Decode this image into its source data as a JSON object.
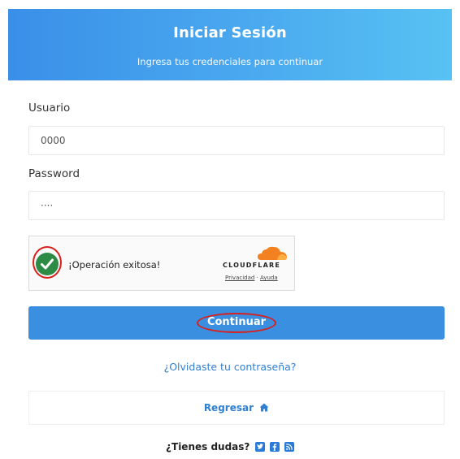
{
  "header": {
    "title": "Iniciar Sesión",
    "subtitle": "Ingresa tus credenciales para continuar"
  },
  "form": {
    "username_label": "Usuario",
    "username_value": "0000",
    "password_label": "Password",
    "password_value": "····"
  },
  "captcha": {
    "status_icon": "check-circle-icon",
    "message": "¡Operación exitosa!",
    "provider": "CLOUDFLARE",
    "privacy_link": "Privacidad",
    "separator": "·",
    "help_link": "Ayuda"
  },
  "actions": {
    "continue_label": "Continuar",
    "forgot_label": "¿Olvidaste tu contraseña?",
    "back_label": "Regresar",
    "back_icon": "home-icon"
  },
  "footer": {
    "question": "¿Tienes dudas?",
    "social_icons": [
      "twitter-icon",
      "facebook-icon",
      "rss-icon"
    ]
  },
  "colors": {
    "header_gradient_start": "#3a8fe8",
    "header_gradient_end": "#58c2f3",
    "primary_button": "#3a8fe0",
    "link": "#2f7fd3",
    "success_green": "#2e8b45",
    "annotation_red": "#d8201c",
    "cloudflare_orange": "#f48120"
  }
}
